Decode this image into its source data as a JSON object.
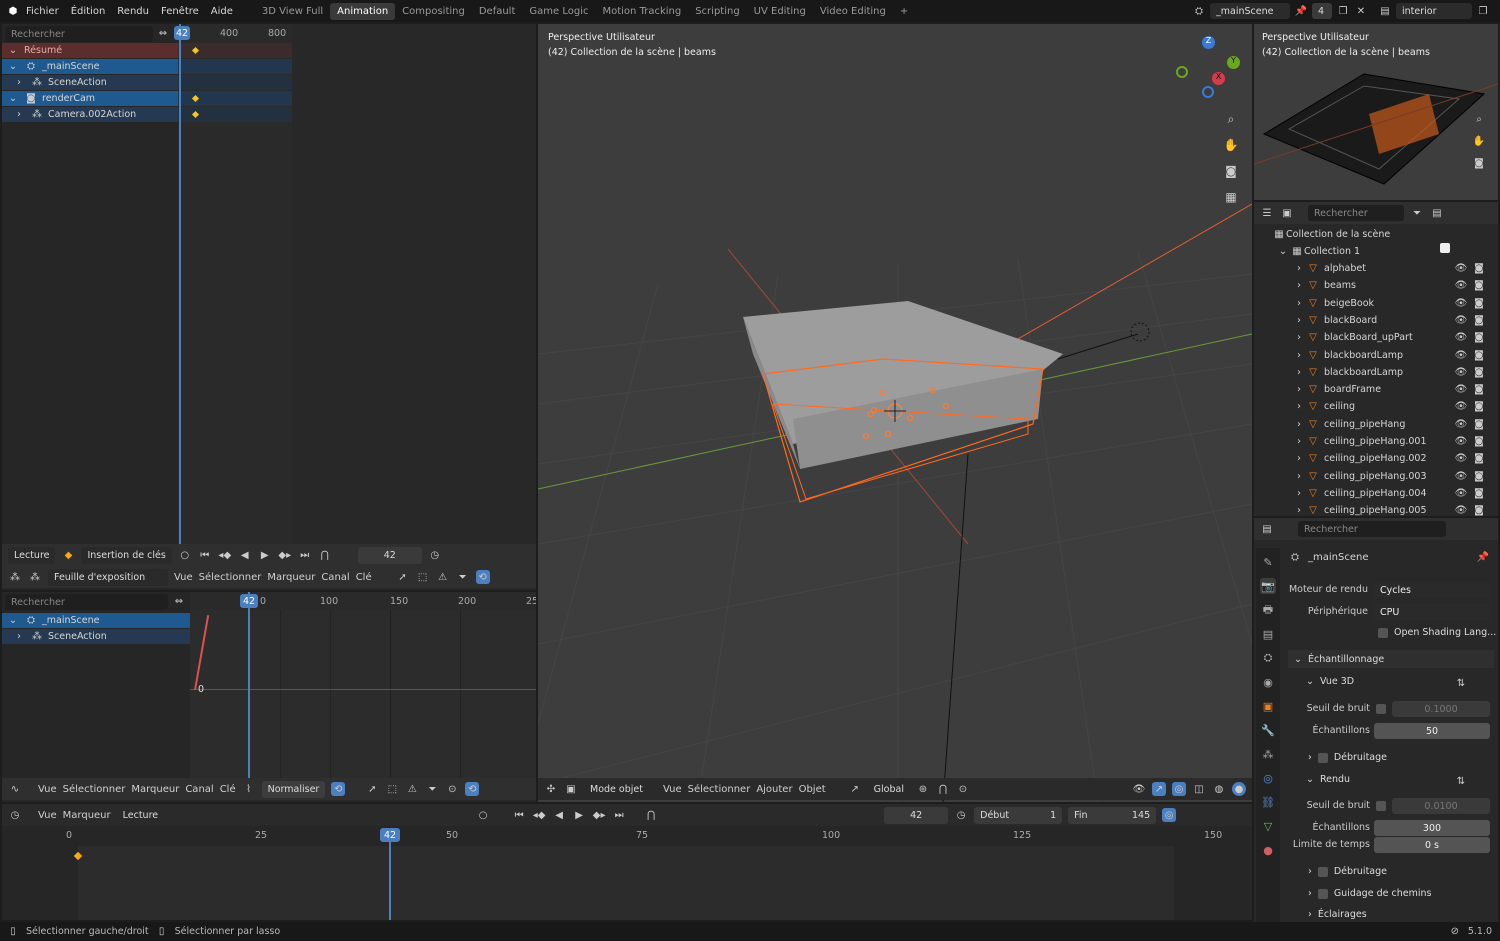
{
  "menu": [
    "Fichier",
    "Édition",
    "Rendu",
    "Fenêtre",
    "Aide"
  ],
  "workspaces": [
    "3D View Full",
    "Animation",
    "Compositing",
    "Default",
    "Game Logic",
    "Motion Tracking",
    "Scripting",
    "UV Editing",
    "Video Editing"
  ],
  "workspace_add": "+",
  "top_right": {
    "scene": "_mainScene",
    "users": "4",
    "view_layer": "interior"
  },
  "dopesheet": {
    "search_placeholder": "Rechercher",
    "current_frame_badge": "42",
    "ticks": [
      "400",
      "800"
    ],
    "channels": [
      "Résumé",
      "_mainScene",
      "SceneAction",
      "renderCam",
      "Camera.002Action"
    ],
    "footer": {
      "playback": "Lecture",
      "keying": "Insertion de clés",
      "frame": "42",
      "mode": "Feuille d'exposition",
      "menus": [
        "Vue",
        "Sélectionner",
        "Marqueur",
        "Canal",
        "Clé"
      ]
    }
  },
  "graph": {
    "search_placeholder": "Rechercher",
    "current_frame_badge": "42",
    "ticks": [
      "0",
      "100",
      "150",
      "200",
      "25"
    ],
    "channels": [
      "_mainScene",
      "SceneAction"
    ],
    "zero_label": "0",
    "footer": {
      "menus": [
        "Vue",
        "Sélectionner",
        "Marqueur",
        "Canal",
        "Clé"
      ],
      "normalize": "Normaliser"
    }
  },
  "viewport": {
    "title": "Perspective Utilisateur",
    "subtitle": "(42) Collection de la scène | beams",
    "axes": {
      "z": "Z",
      "y": "Y",
      "x": "X"
    },
    "footer": {
      "mode": "Mode objet",
      "menus": [
        "Vue",
        "Sélectionner",
        "Ajouter",
        "Objet"
      ],
      "orientation": "Global"
    }
  },
  "camview": {
    "title": "Perspective Utilisateur",
    "subtitle": "(42) Collection de la scène | beams"
  },
  "outliner": {
    "search_placeholder": "Rechercher",
    "scene_collection": "Collection de la scène",
    "collection": "Collection 1",
    "items": [
      "alphabet",
      "beams",
      "beigeBook",
      "blackBoard",
      "blackBoard_upPart",
      "blackboardLamp",
      "blackboardLamp",
      "boardFrame",
      "ceiling",
      "ceiling_pipeHang",
      "ceiling_pipeHang.001",
      "ceiling_pipeHang.002",
      "ceiling_pipeHang.003",
      "ceiling_pipeHang.004",
      "ceiling_pipeHang.005"
    ]
  },
  "properties": {
    "search_placeholder": "Rechercher",
    "scene": "_mainScene",
    "render_engine_label": "Moteur de rendu",
    "render_engine": "Cycles",
    "device_label": "Périphérique",
    "device": "CPU",
    "osl": "Open Shading Lang...",
    "sampling": "Échantillonnage",
    "viewport": "Vue 3D",
    "noise_threshold_label": "Seuil de bruit",
    "vp_noise": "0.1000",
    "samples_label": "Échantillons",
    "vp_samples": "50",
    "denoise": "Débruitage",
    "render": "Rendu",
    "r_noise": "0.0100",
    "r_samples": "300",
    "time_limit_label": "Limite de temps",
    "time_limit": "0 s",
    "path_guiding": "Guidage de chemins",
    "lights": "Éclairages"
  },
  "timeline": {
    "menus": [
      "Vue",
      "Marqueur",
      "Lecture"
    ],
    "frame": "42",
    "start_label": "Début",
    "start": "1",
    "end_label": "Fin",
    "end": "145",
    "current_frame_badge": "42",
    "ticks": [
      "0",
      "25",
      "50",
      "75",
      "100",
      "125",
      "150"
    ]
  },
  "status": {
    "left1": "Sélectionner gauche/droit",
    "left2": "Sélectionner par lasso",
    "version": "5.1.0"
  }
}
